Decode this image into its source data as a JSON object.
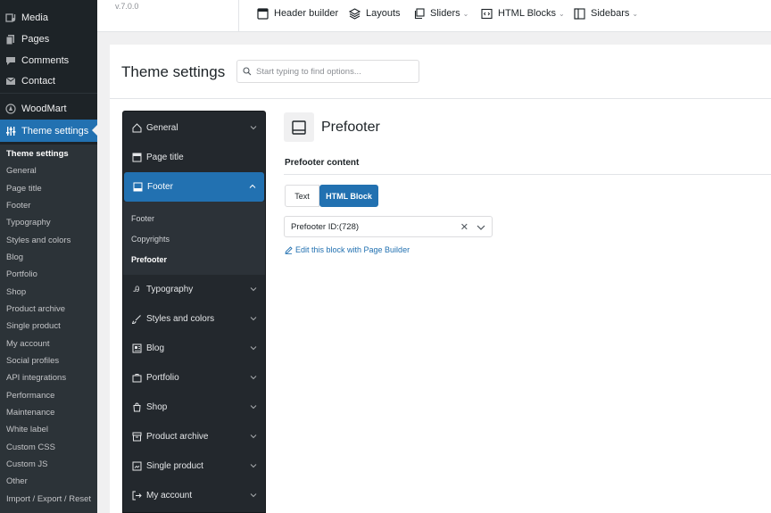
{
  "wp_menu": {
    "items": [
      {
        "label": "Media",
        "icon": "media-icon"
      },
      {
        "label": "Pages",
        "icon": "pages-icon"
      },
      {
        "label": "Comments",
        "icon": "comments-icon"
      },
      {
        "label": "Contact",
        "icon": "contact-icon"
      },
      {
        "label": "WoodMart",
        "icon": "woodmart-icon"
      },
      {
        "label": "Theme settings",
        "icon": "sliders-icon"
      }
    ],
    "submenu": [
      "Theme settings",
      "General",
      "Page title",
      "Footer",
      "Typography",
      "Styles and colors",
      "Blog",
      "Portfolio",
      "Shop",
      "Product archive",
      "Single product",
      "My account",
      "Social profiles",
      "API integrations",
      "Performance",
      "Maintenance",
      "White label",
      "Custom CSS",
      "Custom JS",
      "Other",
      "Import / Export / Reset"
    ]
  },
  "topbar": {
    "version": "v.7.0.0",
    "links": [
      {
        "label": "Header builder",
        "icon": "header-builder-icon",
        "dropdown": false
      },
      {
        "label": "Layouts",
        "icon": "layers-icon",
        "dropdown": false
      },
      {
        "label": "Sliders",
        "icon": "sliders-stack-icon",
        "dropdown": true
      },
      {
        "label": "HTML Blocks",
        "icon": "code-block-icon",
        "dropdown": true
      },
      {
        "label": "Sidebars",
        "icon": "sidebar-icon",
        "dropdown": true
      }
    ]
  },
  "header": {
    "title": "Theme settings",
    "search_placeholder": "Start typing to find options..."
  },
  "options_nav": {
    "items": [
      {
        "label": "General",
        "icon": "home-icon"
      },
      {
        "label": "Page title",
        "icon": "page-title-icon"
      },
      {
        "label": "Footer",
        "icon": "footer-icon"
      },
      {
        "label": "Typography",
        "icon": "typography-icon"
      },
      {
        "label": "Styles and colors",
        "icon": "brush-icon"
      },
      {
        "label": "Blog",
        "icon": "blog-icon"
      },
      {
        "label": "Portfolio",
        "icon": "portfolio-icon"
      },
      {
        "label": "Shop",
        "icon": "shop-icon"
      },
      {
        "label": "Product archive",
        "icon": "archive-icon"
      },
      {
        "label": "Single product",
        "icon": "product-icon"
      },
      {
        "label": "My account",
        "icon": "account-icon"
      }
    ],
    "footer_sub": [
      "Footer",
      "Copyrights",
      "Prefooter"
    ]
  },
  "content": {
    "section_title": "Prefooter",
    "field_label": "Prefooter content",
    "tab_text": "Text",
    "tab_html": "HTML Block",
    "select_value": "Prefooter ID:(728)",
    "clear_glyph": "✕",
    "edit_link": "Edit this block with Page Builder"
  },
  "colors": {
    "accent": "#2271b1",
    "wp_sidebar": "#1d2327",
    "options_nav": "#23282d"
  }
}
